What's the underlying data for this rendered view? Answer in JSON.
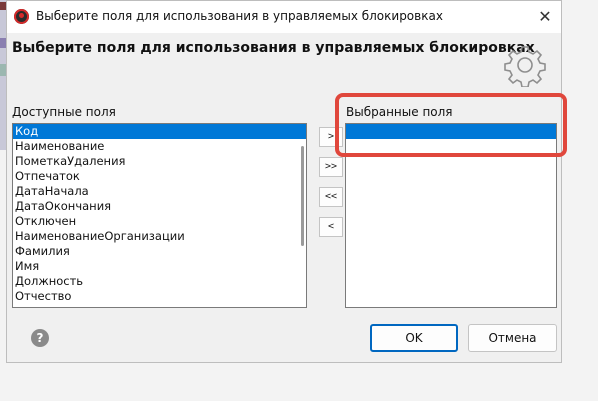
{
  "window": {
    "title": "Выберите поля для использования в управляемых блокировках",
    "close_glyph": "✕"
  },
  "header": {
    "text": "Выберите поля для использования в управляемых блокировках",
    "icon": "gear-icon"
  },
  "available": {
    "label": "Доступные поля",
    "items": [
      "Код",
      "Наименование",
      "ПометкаУдаления",
      "Отпечаток",
      "ДатаНачала",
      "ДатаОкончания",
      "Отключен",
      "НаименованиеОрганизации",
      "Фамилия",
      "Имя",
      "Должность",
      "Отчество"
    ],
    "selected_index": 0
  },
  "transfer_buttons": {
    "add_one": ">",
    "add_all": ">>",
    "remove_all": "<<",
    "remove_one": "<"
  },
  "selected": {
    "label": "Выбранные поля",
    "items": [
      ""
    ],
    "selected_index": 0
  },
  "footer": {
    "help_glyph": "?",
    "ok_label": "OK",
    "cancel_label": "Отмена"
  },
  "colors": {
    "selection": "#0078d7",
    "highlight_annotation": "#e0473c",
    "default_button_border": "#0067c0"
  }
}
